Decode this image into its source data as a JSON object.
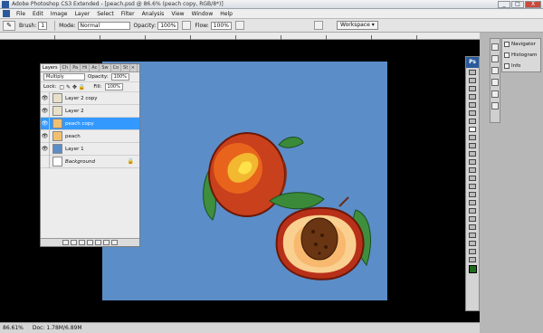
{
  "window": {
    "title": "Adobe Photoshop CS3 Extended - [peach.psd @ 86.6% (peach copy, RGB/8*)]",
    "controls": [
      "_",
      "□",
      "X"
    ]
  },
  "menu": [
    "File",
    "Edit",
    "Image",
    "Layer",
    "Select",
    "Filter",
    "Analysis",
    "View",
    "Window",
    "Help"
  ],
  "options": {
    "brush_label": "Brush:",
    "brush_size": "1",
    "mode_label": "Mode:",
    "mode_value": "Normal",
    "opacity_label": "Opacity:",
    "opacity_value": "100%",
    "flow_label": "Flow:",
    "flow_value": "100%",
    "workspace": "Workspace ▾"
  },
  "layers_panel": {
    "tabs": [
      "Layers",
      "Ch",
      "Pa",
      "Hi",
      "Ac",
      "Sw",
      "Co",
      "St"
    ],
    "blend_mode": "Multiply",
    "opacity_label": "Opacity:",
    "opacity_value": "100%",
    "lock_label": "Lock:",
    "fill_label": "Fill:",
    "fill_value": "100%",
    "layers": [
      {
        "name": "Layer 2 copy",
        "visible": true,
        "selected": false,
        "thumb": "#e8e0c8"
      },
      {
        "name": "Layer 2",
        "visible": true,
        "selected": false,
        "thumb": "#e8e0c8"
      },
      {
        "name": "peach copy",
        "visible": true,
        "selected": true,
        "thumb": "#f0c070"
      },
      {
        "name": "peach",
        "visible": true,
        "selected": false,
        "thumb": "#f0c070"
      },
      {
        "name": "Layer 1",
        "visible": true,
        "selected": false,
        "thumb": "#5b8dc8"
      },
      {
        "name": "Background",
        "visible": false,
        "selected": false,
        "thumb": "#ffffff"
      }
    ]
  },
  "right_panel": {
    "items": [
      "Navigator",
      "Histogram",
      "Info"
    ]
  },
  "toolbox": {
    "header": "Ps"
  },
  "status": {
    "zoom": "86.61%",
    "doc": "Doc: 1.78M/6.89M"
  },
  "colors": {
    "canvas_bg": "#5b8dc8",
    "selection": "#3399ff",
    "foreground_swatch": "#1e6b1e"
  }
}
